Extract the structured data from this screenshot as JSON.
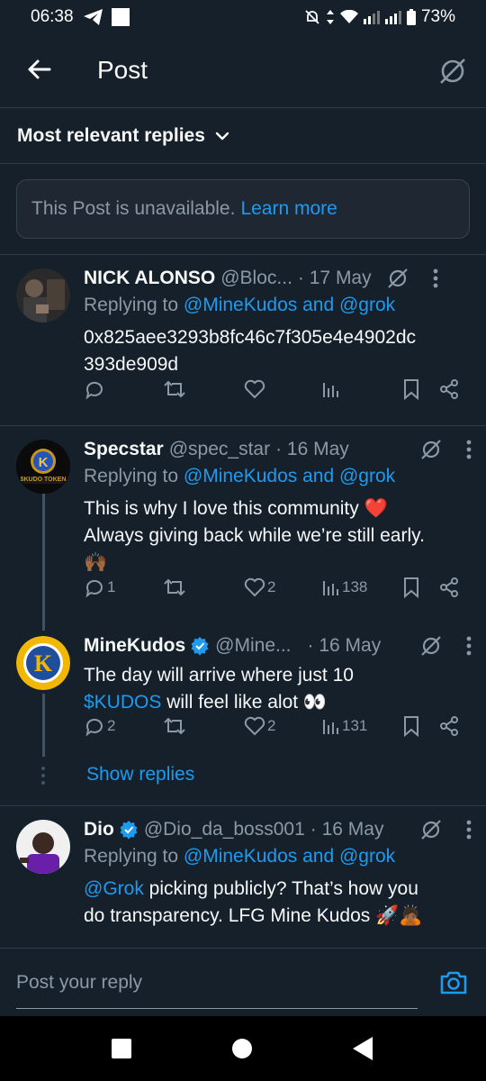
{
  "status_bar": {
    "time": "06:38",
    "battery": "73%"
  },
  "header": {
    "title": "Post",
    "back_icon": "arrow-left-icon",
    "grok_icon": "grok-icon"
  },
  "sort": {
    "label": "Most relevant replies"
  },
  "notice": {
    "text": "This Post is unavailable.",
    "link": "Learn more"
  },
  "posts": [
    {
      "name": "NICK ALONSO",
      "handle": "@Bloc...",
      "date": "· 17 May",
      "replying_prefix": "Replying to",
      "replying_to": "@MineKudos and @grok",
      "text_line1": "0x825aee3293b8fc46c7f305e4e4902dc",
      "text_line2": "393de909d",
      "replies": "",
      "reposts": "",
      "likes": "",
      "views": ""
    },
    {
      "name": "Specstar",
      "handle": "@spec_star",
      "date": "· 16 May",
      "replying_prefix": "Replying to",
      "replying_to": "@MineKudos and @grok",
      "text_line1": "This is why I love this community ❤️",
      "text_line2": "Always giving back while we’re still early.",
      "text_line3": "🙌🏾",
      "avatar_label": "$KUDO TOKEN",
      "replies": "1",
      "reposts": "",
      "likes": "2",
      "views": "138"
    },
    {
      "name": "MineKudos",
      "handle": "@Mine...",
      "date": "· 16 May",
      "text_line1": "The day will arrive where just 10",
      "text_mention": "$KUDOS",
      "text_rest": " will feel like alot 👀",
      "avatar_letter": "K",
      "replies": "2",
      "reposts": "",
      "likes": "2",
      "views": "131"
    },
    {
      "name": "Dio",
      "handle": "@Dio_da_boss001",
      "date": "· 16 May",
      "replying_prefix": "Replying to",
      "replying_to": "@MineKudos and @grok",
      "text_mention": "@Grok",
      "text_line1": " picking publicly? That’s how you",
      "text_line2": "do transparency. LFG Mine Kudos 🚀🙇🏾"
    }
  ],
  "show_replies": "Show replies",
  "reply_input": {
    "placeholder": "Post your reply"
  },
  "colors": {
    "background": "#15202b",
    "accent": "#1d9bf0",
    "muted": "#8b98a5",
    "like": "#f91880"
  }
}
